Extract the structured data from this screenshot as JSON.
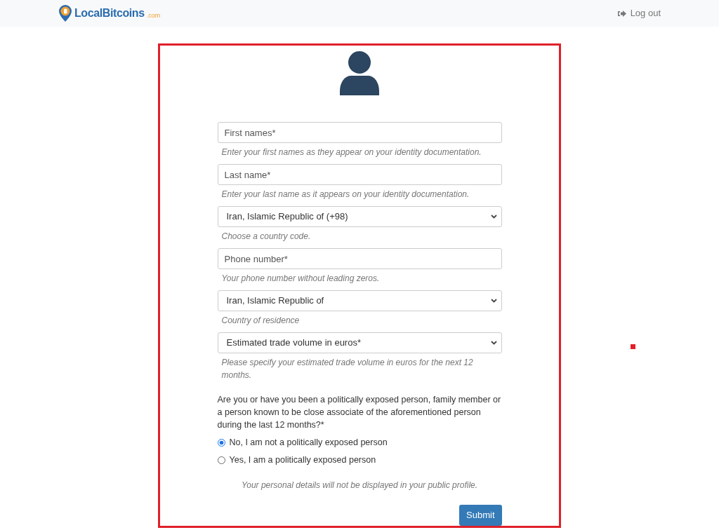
{
  "header": {
    "logo_name": "LocalBitcoins",
    "logo_suffix": ".com",
    "logout": "Log out"
  },
  "fields": [
    {
      "kind": "input",
      "placeholder": "First names*",
      "hint": "Enter your first names as they appear on your identity documentation."
    },
    {
      "kind": "input",
      "placeholder": "Last name*",
      "hint": "Enter your last name as it appears on your identity documentation."
    },
    {
      "kind": "select",
      "value": "Iran, Islamic Republic of (+98)",
      "hint": "Choose a country code."
    },
    {
      "kind": "input",
      "placeholder": "Phone number*",
      "hint": "Your phone number without leading zeros."
    },
    {
      "kind": "select",
      "value": "Iran, Islamic Republic of",
      "hint": "Country of residence"
    },
    {
      "kind": "select",
      "value": "Estimated trade volume in euros*",
      "hint": "Please specify your estimated trade volume in euros for the next 12 months."
    }
  ],
  "question": "Are you or have you been a politically exposed person, family member or a person known to be close associate of the aforementioned person during the last 12 months?*",
  "options": [
    {
      "label": "No, I am not a politically exposed person",
      "selected": true
    },
    {
      "label": "Yes, I am a politically exposed person",
      "selected": false
    }
  ],
  "privacy_note": "Your personal details will not be displayed in your public profile.",
  "submit": "Submit"
}
